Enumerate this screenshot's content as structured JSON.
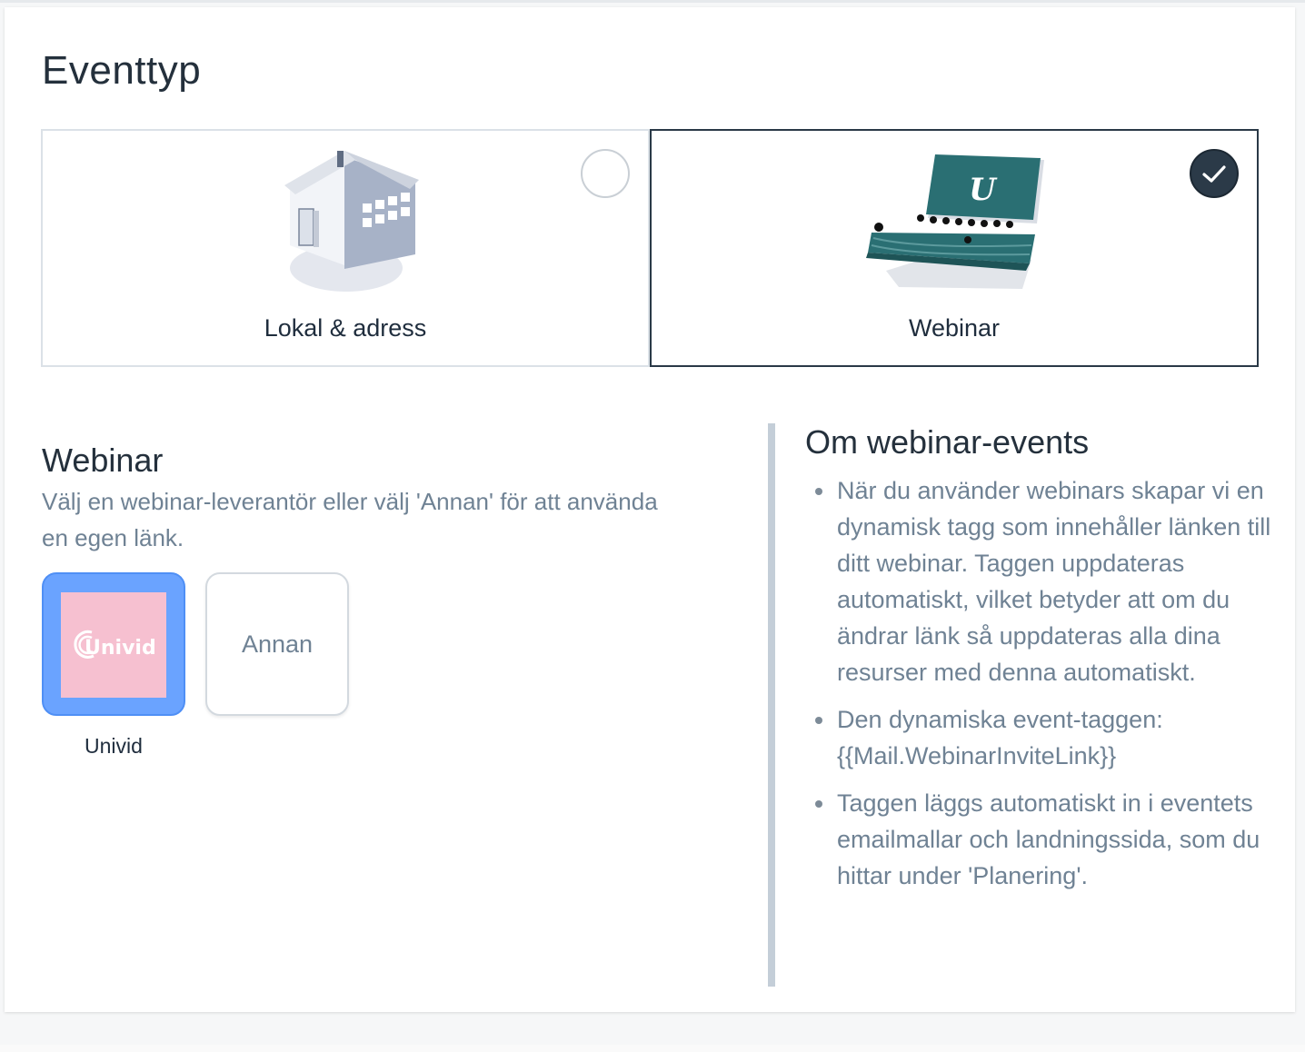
{
  "header": {
    "title": "Eventtyp"
  },
  "event_types": [
    {
      "label": "Lokal & adress",
      "selected": false,
      "icon": "house-icon"
    },
    {
      "label": "Webinar",
      "selected": true,
      "icon": "webinar-screen-icon",
      "screen_letter": "U"
    }
  ],
  "webinar": {
    "title": "Webinar",
    "description": "Välj en webinar-leverantör eller välj 'Annan' för att använda en egen länk.",
    "providers": [
      {
        "name": "Univid",
        "logo_text": "Univid",
        "selected": true
      },
      {
        "name": "Annan",
        "selected": false
      }
    ]
  },
  "info": {
    "title": "Om webinar-events",
    "items": [
      "När du använder webinars skapar vi en dynamisk tagg som innehåller länken till ditt webinar. Taggen uppdateras automatiskt, vilket betyder att om du ändrar länk så uppdateras alla dina resurser med denna automatiskt.",
      "Den dynamiska event-taggen: {{Mail.WebinarInviteLink}}",
      "Taggen läggs automatiskt in i eventets emailmallar och landningssida, som du hittar under 'Planering'."
    ]
  },
  "colors": {
    "selected_border": "#2a3947",
    "univid_blue": "#6aa3ff",
    "univid_pink": "#f6c0d0",
    "teal": "#2a6f73",
    "muted_text": "#6f8294"
  }
}
